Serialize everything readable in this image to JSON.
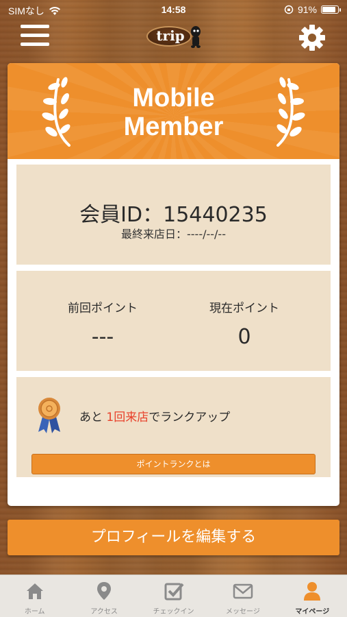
{
  "status_bar": {
    "carrier": "SIMなし",
    "time": "14:58",
    "battery": "91%",
    "battery_level": 0.91
  },
  "header": {
    "logo_text": "trip",
    "menu_icon": "hamburger-icon",
    "settings_icon": "gear-icon"
  },
  "banner": {
    "title_line1": "Mobile",
    "title_line2": "Member"
  },
  "member": {
    "id_label": "会員ID：15440235",
    "last_visit": "最終来店日：----/--/--"
  },
  "points": {
    "previous_label": "前回ポイント",
    "previous_value": "---",
    "current_label": "現在ポイント",
    "current_value": "0"
  },
  "rank": {
    "text_before": "あと ",
    "highlight": "1回来店",
    "text_after": "でランクアップ",
    "button_label": "ポイントランクとは",
    "highlight_color": "#e8412b"
  },
  "profile_button": "プロフィールを編集する",
  "tabs": [
    {
      "label": "ホーム",
      "icon": "home-icon"
    },
    {
      "label": "アクセス",
      "icon": "map-pin-icon"
    },
    {
      "label": "チェックイン",
      "icon": "checkin-icon"
    },
    {
      "label": "メッセージ",
      "icon": "envelope-icon"
    },
    {
      "label": "マイページ",
      "icon": "user-icon",
      "active": true
    }
  ],
  "colors": {
    "accent": "#ee8f2c",
    "panel": "#efe0c9"
  }
}
